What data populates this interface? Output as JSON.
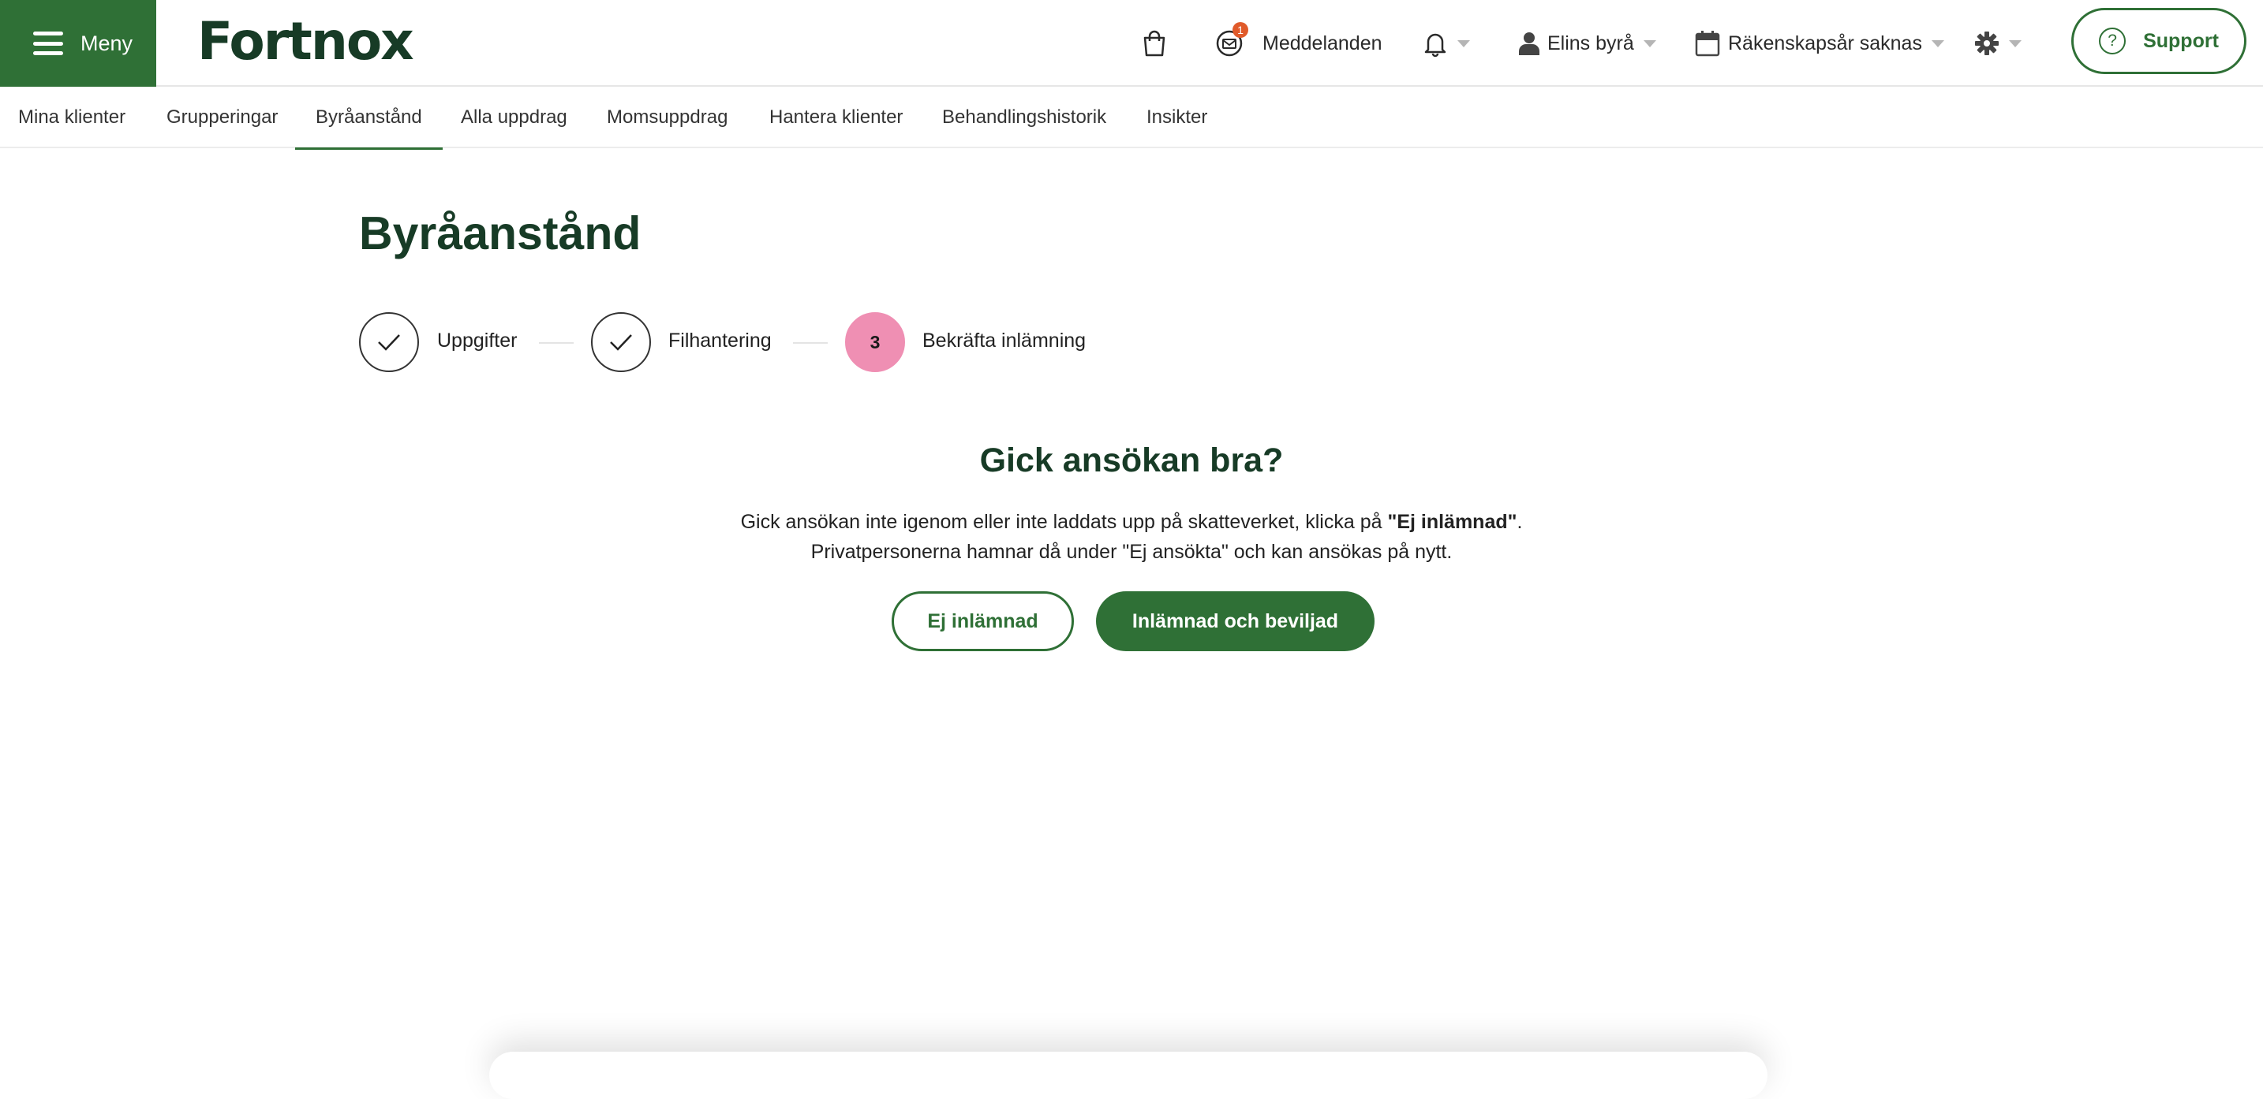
{
  "header": {
    "menu_label": "Meny",
    "logo_text": "Fortnox",
    "cart_icon": "shopping-bag-icon",
    "messages_label": "Meddelanden",
    "messages_badge": "1",
    "bell_icon": "bell-icon",
    "user_label": "Elins byrå",
    "fiscal_label": "Räkenskapsår saknas",
    "settings_icon": "gear-icon",
    "support_label": "Support",
    "brand_color": "#2f7036"
  },
  "nav": {
    "tabs": [
      {
        "label": "Mina klienter"
      },
      {
        "label": "Grupperingar"
      },
      {
        "label": "Byråanstånd"
      },
      {
        "label": "Alla uppdrag"
      },
      {
        "label": "Momsuppdrag"
      },
      {
        "label": "Hantera klienter"
      },
      {
        "label": "Behandlingshistorik"
      },
      {
        "label": "Insikter"
      }
    ],
    "active_tab": "Byråanstånd"
  },
  "page": {
    "title": "Byråanstånd",
    "steps": [
      {
        "label": "Uppgifter",
        "state": "done"
      },
      {
        "label": "Filhantering",
        "state": "done"
      },
      {
        "label": "Bekräfta inlämning",
        "state": "current",
        "number": "3"
      }
    ],
    "current_step_color": "#ef8fb3",
    "question": "Gick ansökan bra?",
    "desc_line1_prefix": "Gick ansökan inte igenom eller inte laddats upp på skatteverket, klicka på ",
    "desc_line1_bold": "\"Ej inlämnad\"",
    "desc_line1_suffix": ".",
    "desc_line2": "Privatpersonerna hamnar då under \"Ej ansökta\" och kan ansökas på nytt.",
    "button_not_submitted": "Ej inlämnad",
    "button_submitted": "Inlämnad och beviljad"
  }
}
